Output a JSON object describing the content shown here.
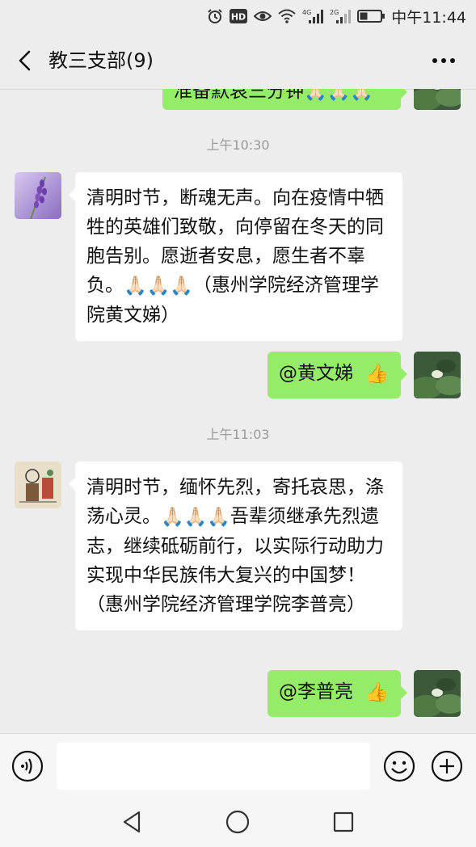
{
  "status_bar": {
    "time": "中午11:44",
    "signal_4g": "4G",
    "signal_2g": "2G",
    "hd_label": "HD",
    "icons": [
      "alarm-icon",
      "hd-icon",
      "eye-icon",
      "wifi-icon",
      "signal-4g-icon",
      "signal-2g-icon",
      "battery-icon"
    ]
  },
  "header": {
    "title": "教三支部(9)",
    "back_icon": "back-icon",
    "more_icon": "more-icon"
  },
  "messages": [
    {
      "type": "outgoing",
      "text": "准备默哀三分钟🙏🏻🙏🏻🙏🏻",
      "partially_visible": true
    },
    {
      "type": "time",
      "text": "上午10:30"
    },
    {
      "type": "incoming",
      "text_before": "清明时节，断魂无声。向在疫情中牺牲的英雄们致敬，向停留在冬天的同胞告别。愿逝者安息，愿生者不辜负。",
      "emoji": "🙏🏻🙏🏻🙏🏻",
      "text_after": "（惠州学院经济管理学院黄文娣）"
    },
    {
      "type": "outgoing",
      "text": "@黄文娣",
      "emoji": "👍"
    },
    {
      "type": "time",
      "text": "上午11:03"
    },
    {
      "type": "incoming",
      "text_before": "清明时节，缅怀先烈，寄托哀思，涤荡心灵。",
      "emoji": "🙏🏻🙏🏻🙏🏻",
      "text_after": "吾辈须继承先烈遗志，继续砥砺前行，以实际行动助力实现中华民族伟大复兴的中国梦！（惠州学院经济管理学院李普亮）"
    },
    {
      "type": "outgoing",
      "text": "@李普亮",
      "emoji": "👍"
    }
  ],
  "input_bar": {
    "voice_icon": "voice-icon",
    "input_value": "",
    "emoji_icon": "emoji-icon",
    "plus_icon": "plus-icon"
  },
  "nav_bar": {
    "icons": [
      "nav-back-icon",
      "nav-home-icon",
      "nav-recent-icon"
    ]
  },
  "colors": {
    "background": "#ededed",
    "outgoing_bubble": "#95ec69",
    "incoming_bubble": "#ffffff",
    "timestamp": "#9a9a9a"
  }
}
